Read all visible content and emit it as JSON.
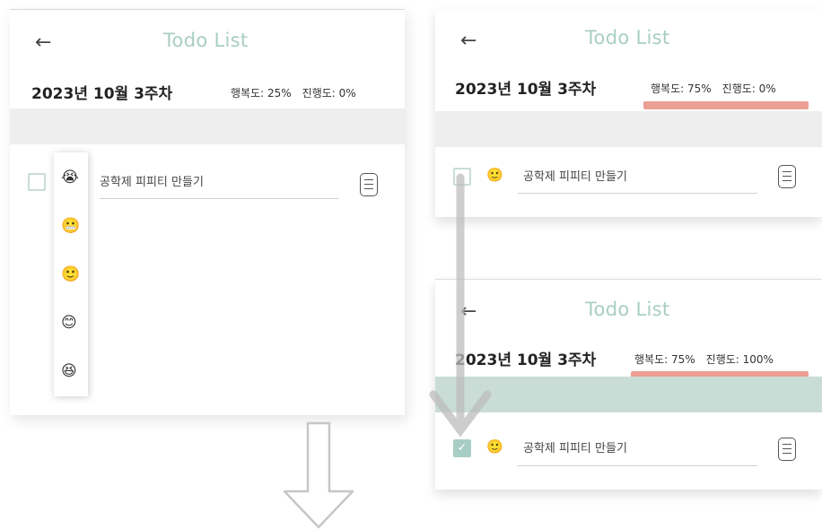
{
  "left": {
    "title": "Todo List",
    "week": "2023년 10월 3주차",
    "happiness": "행복도: 25%",
    "progress": "진행도: 0%",
    "task": "공학제 피피티 만들기",
    "task_icon": "crying-face",
    "emoji_options": [
      "crying-face",
      "grimacing-face",
      "slightly-smiling-face",
      "smiling-face",
      "grinning-face"
    ],
    "checked": false
  },
  "right_top": {
    "title": "Todo List",
    "week": "2023년 10월 3주차",
    "happiness": "행복도: 75%",
    "progress": "진행도: 0%",
    "task": "공학제 피피티 만들기",
    "task_icon": "slightly-smiling-face",
    "checked": false
  },
  "right_bottom": {
    "title": "Todo List",
    "week": "2023년 10월 3주차",
    "happiness": "행복도: 75%",
    "progress": "진행도: 100%",
    "task": "공학제 피피티 만들기",
    "task_icon": "slightly-smiling-face",
    "checked": true
  },
  "colors": {
    "accent": "#a8cec3",
    "highlight": "#ec9f93",
    "gray_band": "#eeeeee",
    "green_band": "#c9ddd6"
  }
}
